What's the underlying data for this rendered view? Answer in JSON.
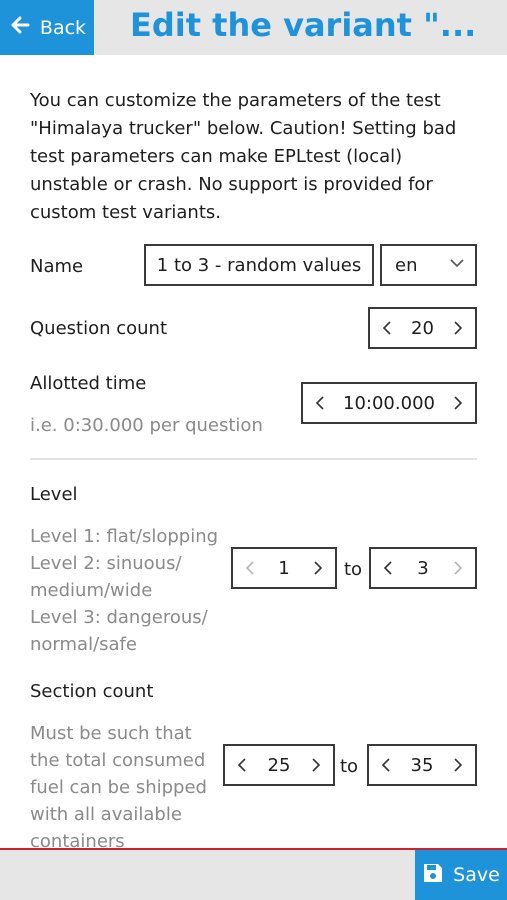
{
  "header": {
    "back_label": "Back",
    "title": "Edit the variant \"..."
  },
  "intro": "You can customize the parameters of the test \"Himalaya trucker\" below. Caution! Setting bad test parameters can make EPLtest (local) unstable or crash. No support is provided for custom test variants.",
  "name_field": {
    "label": "Name",
    "value": "1 to 3 - random values",
    "language": "en"
  },
  "question_count": {
    "label": "Question count",
    "value": "20"
  },
  "allotted_time": {
    "label": "Allotted time",
    "hint": "i.e. 0:30.000 per question",
    "value": "10:00.000"
  },
  "level": {
    "label": "Level",
    "hint": "Level 1: flat/slopping\nLevel 2: sinuous/\nmedium/wide\nLevel 3: dangerous/\nnormal/safe",
    "min": "1",
    "to": "to",
    "max": "3"
  },
  "section_count": {
    "label": "Section count",
    "hint": "Must be such that\nthe total consumed\nfuel can be shipped\nwith all available\ncontainers",
    "min": "25",
    "to": "to",
    "max": "35"
  },
  "footer": {
    "save_label": "Save"
  },
  "colors": {
    "accent": "#1f93d9",
    "bar": "#e6e6e6",
    "bottom_border": "#d0202a",
    "hint": "#8a8a8a"
  }
}
